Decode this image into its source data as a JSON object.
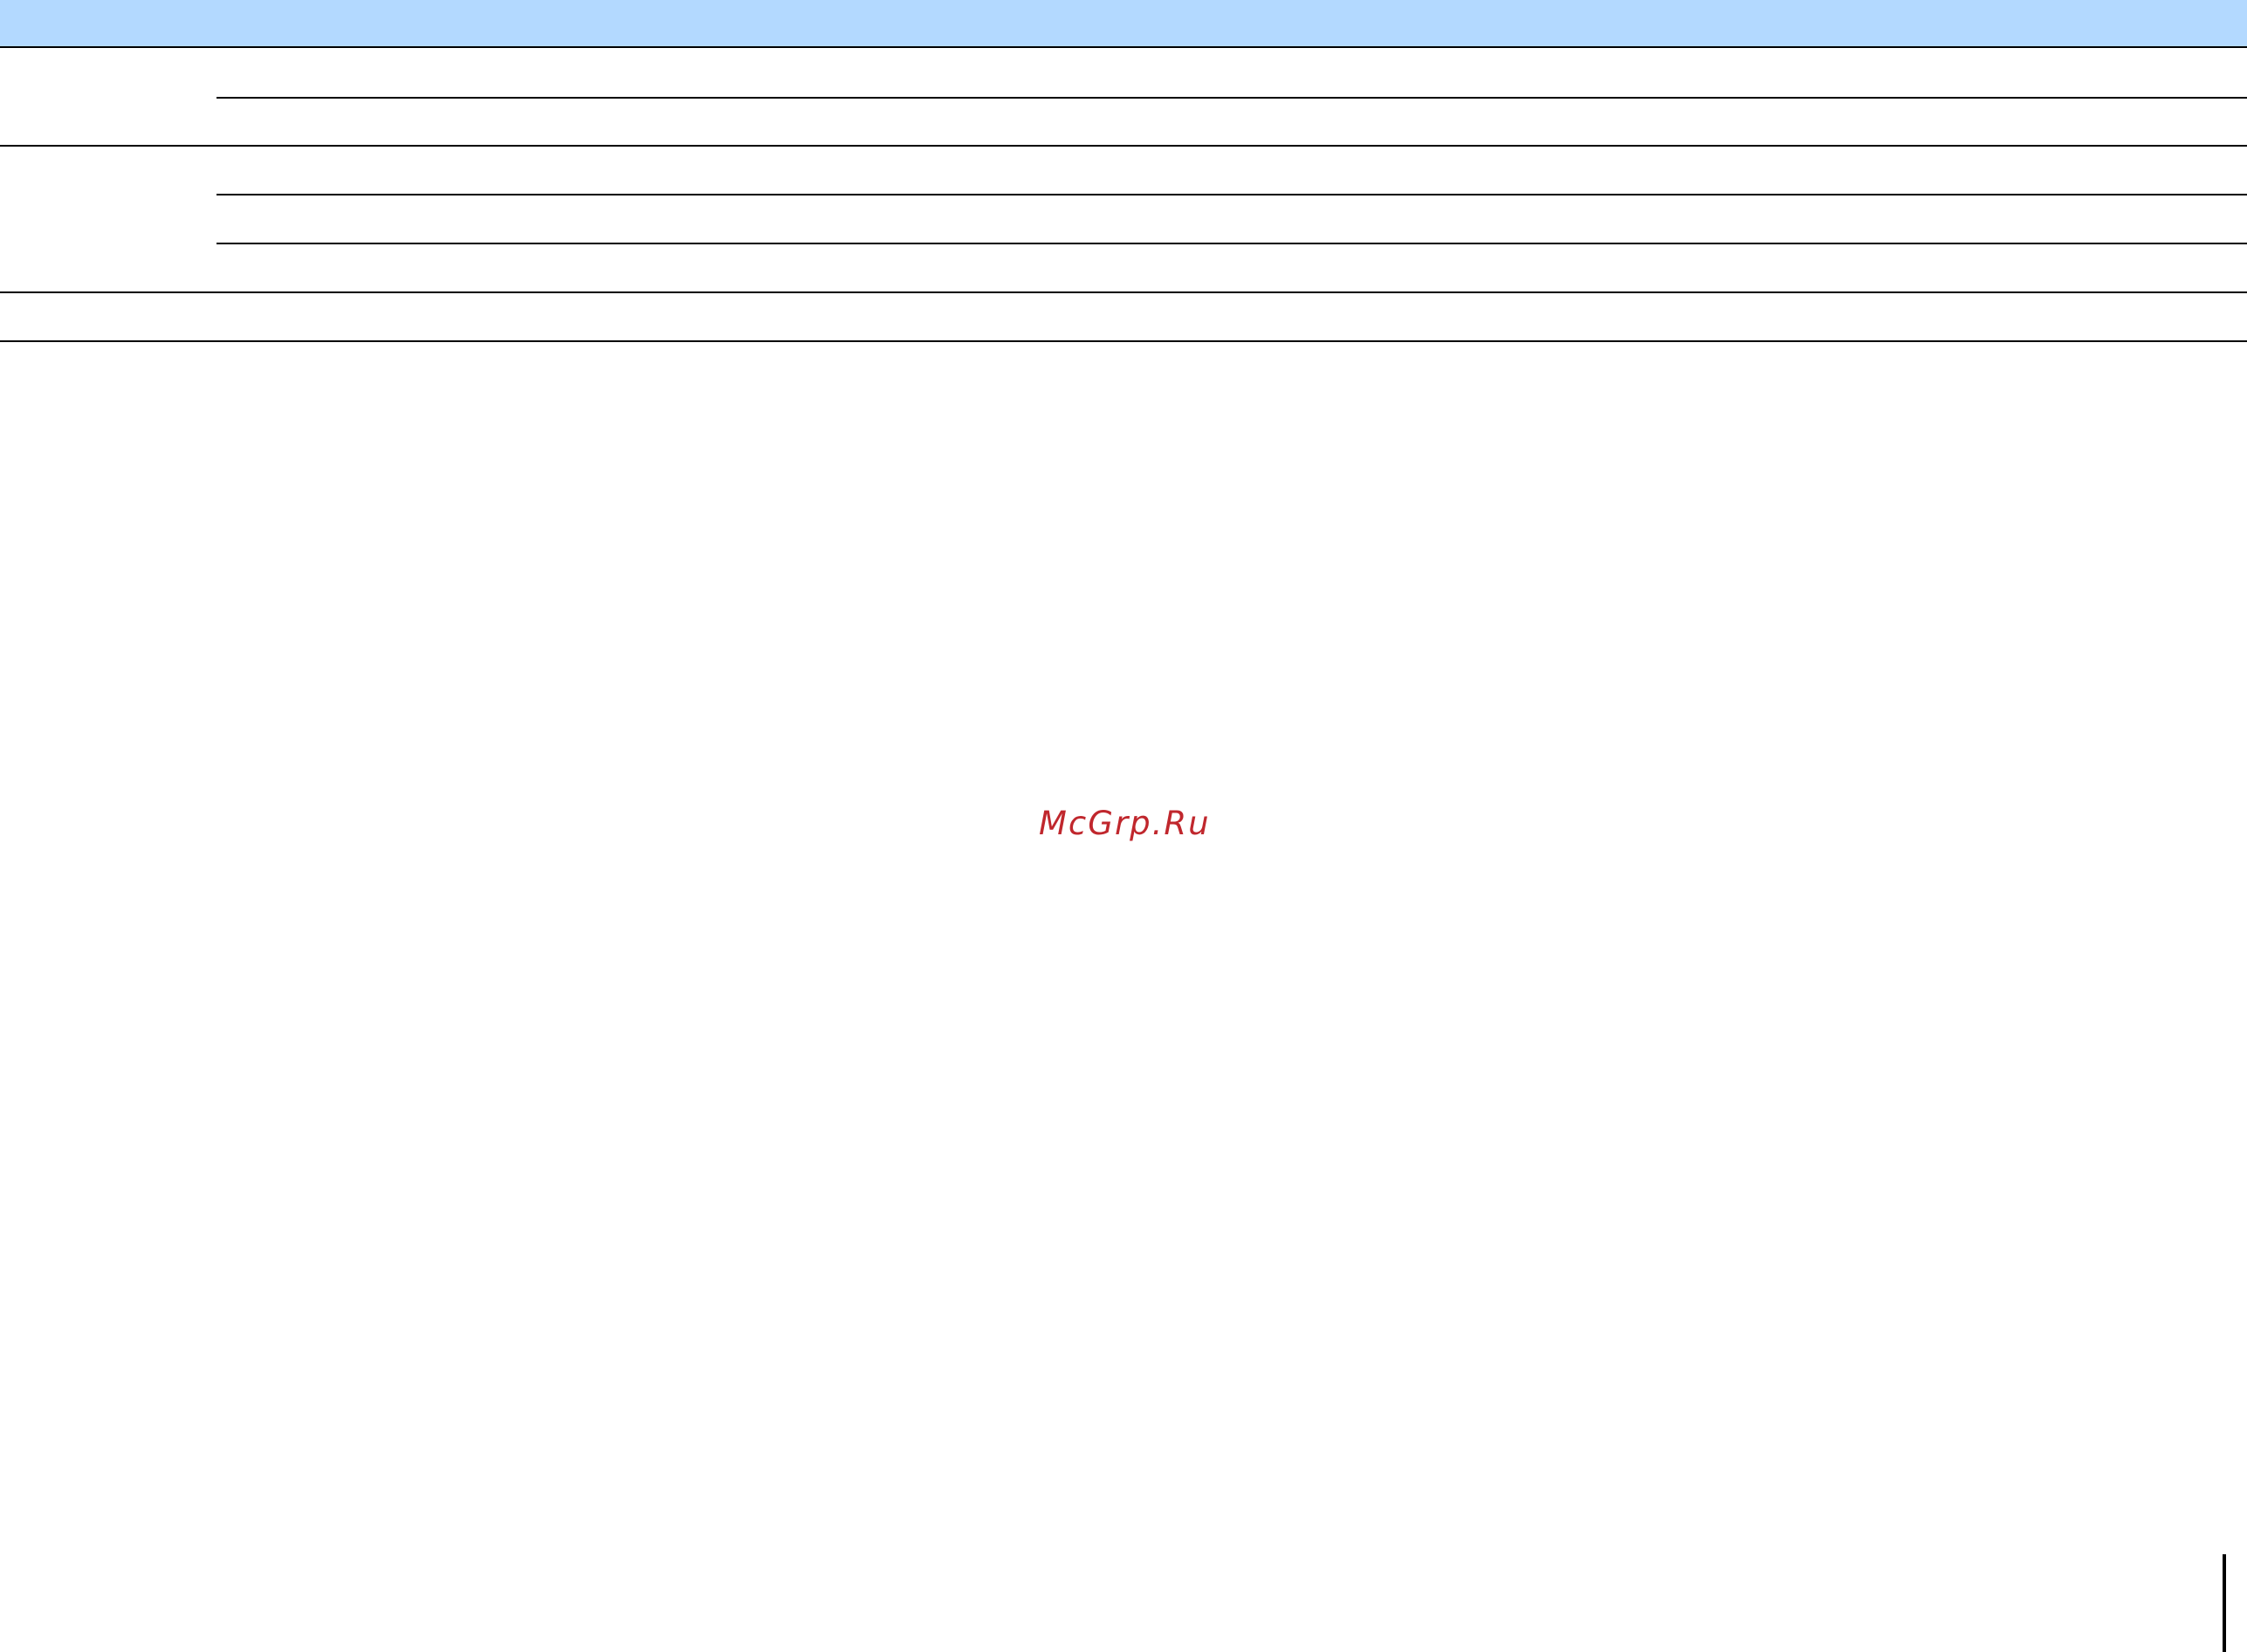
{
  "watermark": {
    "text": "McGrp.Ru",
    "color": "#c0272d"
  },
  "colors": {
    "header_band": "#b3d9ff",
    "rule": "#000000",
    "background": "#ffffff"
  },
  "table": {
    "header": [],
    "groups": [
      {
        "label": "",
        "rows": [
          "",
          ""
        ]
      },
      {
        "label": "",
        "rows": [
          "",
          "",
          ""
        ]
      },
      {
        "label": "",
        "rows": [
          ""
        ]
      }
    ]
  }
}
